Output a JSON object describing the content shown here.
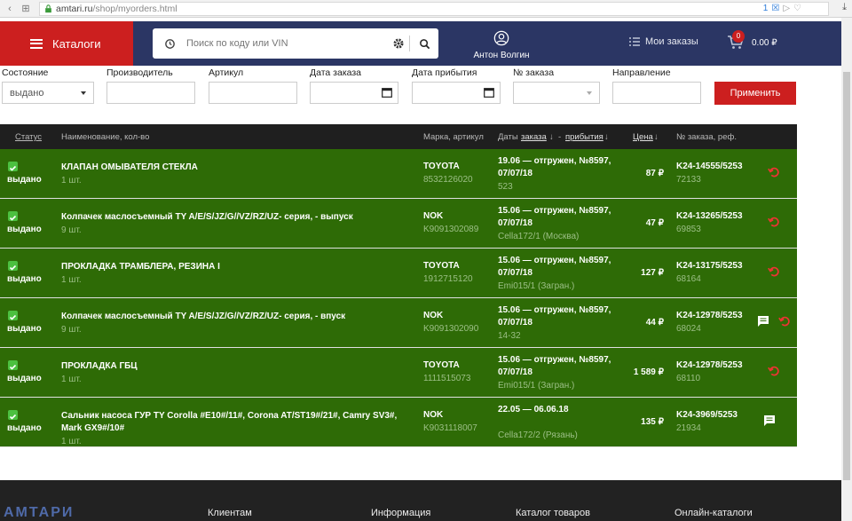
{
  "browser": {
    "url_host": "amtari.ru",
    "url_path": "/shop/myorders.html",
    "notif_count": "1"
  },
  "header": {
    "catalogs_label": "Каталоги",
    "search_placeholder": "Поиск по коду или VIN",
    "user_name": "Антон Волгин",
    "my_orders_label": "Мои заказы",
    "cart_count": "0",
    "cart_total": "0.00 ₽"
  },
  "filters": {
    "status_label": "Состояние",
    "status_value": "выдано",
    "maker_label": "Производитель",
    "article_label": "Артикул",
    "order_date_label": "Дата заказа",
    "arrival_date_label": "Дата прибытия",
    "order_no_label": "№ заказа",
    "direction_label": "Направление",
    "apply_label": "Применить"
  },
  "table": {
    "col_status": "Статус",
    "col_name": "Наименование, кол-во",
    "col_brand": "Марка, артикул",
    "col_dates": "Даты",
    "col_dates_order": "заказа",
    "col_dates_arrival": "прибытия",
    "col_price": "Цена",
    "col_order": "№ заказа, реф.",
    "rows": [
      {
        "status": "выдано",
        "name": "КЛАПАН ОМЫВАТЕЛЯ СТЕКЛА",
        "qty": "1 шт.",
        "brand": "TOYOTA",
        "article": "8532126020",
        "dates": "19.06 — отгружен, №8597, 07/07/18",
        "place": "523",
        "price": "87 ₽",
        "order": "K24-14555/5253",
        "ref": "72133",
        "undo": true,
        "chat": false
      },
      {
        "status": "выдано",
        "name": "Колпачек маслосъемный TY A/E/S/JZ/G//VZ/RZ/UZ- серия, - выпуск",
        "qty": "9 шт.",
        "brand": "NOK",
        "article": "K9091302089",
        "dates": "15.06 — отгружен, №8597, 07/07/18",
        "place": "Cella172/1 (Москва)",
        "price": "47 ₽",
        "order": "K24-13265/5253",
        "ref": "69853",
        "undo": true,
        "chat": false
      },
      {
        "status": "выдано",
        "name": "ПРОКЛАДКА ТРАМБЛЕРА, РЕЗИНА I",
        "qty": "1 шт.",
        "brand": "TOYOTA",
        "article": "1912715120",
        "dates": "15.06 — отгружен, №8597, 07/07/18",
        "place": "Emi015/1 (Загран.)",
        "price": "127 ₽",
        "order": "K24-13175/5253",
        "ref": "68164",
        "undo": true,
        "chat": false
      },
      {
        "status": "выдано",
        "name": "Колпачек маслосъемный TY A/E/S/JZ/G//VZ/RZ/UZ- серия, - впуск",
        "qty": "9 шт.",
        "brand": "NOK",
        "article": "K9091302090",
        "dates": "15.06 — отгружен, №8597, 07/07/18",
        "place": "14-32",
        "price": "44 ₽",
        "order": "K24-12978/5253",
        "ref": "68024",
        "undo": true,
        "chat": true
      },
      {
        "status": "выдано",
        "name": "ПРОКЛАДКА ГБЦ",
        "qty": "1 шт.",
        "brand": "TOYOTA",
        "article": "1111515073",
        "dates": "15.06 — отгружен, №8597, 07/07/18",
        "place": "Emi015/1 (Загран.)",
        "price": "1 589 ₽",
        "order": "K24-12978/5253",
        "ref": "68110",
        "undo": true,
        "chat": false
      },
      {
        "status": "выдано",
        "name": "Сальник насоса ГУР TY Corolla #E10#/11#, Corona AT/ST19#/21#, Camry SV3#, Mark GX9#/10#",
        "qty": "1 шт.",
        "brand": "NOK",
        "article": "K9031118007",
        "dates": "22.05 — 06.06.18",
        "place": "Cella172/2 (Рязань)",
        "price": "135 ₽",
        "order": "K24-3969/5253",
        "ref": "21934",
        "undo": false,
        "chat": true
      }
    ]
  },
  "footer": {
    "logo": "АМТАРИ",
    "clients": "Клиентам",
    "info": "Информация",
    "catalog": "Каталог товаров",
    "online": "Онлайн-каталоги"
  },
  "colors": {
    "header_bg": "#2b3664",
    "accent_red": "#cc1f1f",
    "row_green": "#2e6b06",
    "table_head": "#1f1f1f",
    "footer_bg": "#222222"
  }
}
